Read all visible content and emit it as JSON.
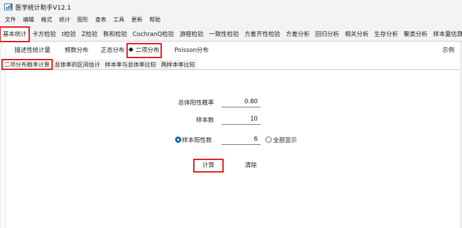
{
  "window": {
    "title": "医学统计助手V12.1"
  },
  "menu": [
    "文件",
    "编辑",
    "格式",
    "统计",
    "图形",
    "查表",
    "工具",
    "更新",
    "帮助"
  ],
  "main_tabs": [
    "基本统计",
    "卡方检验",
    "t检验",
    "Z检验",
    "秩和检验",
    "CochranQ检验",
    "游程检验",
    "一致性检验",
    "方差齐性检验",
    "方差分析",
    "回归分析",
    "相关分析",
    "生存分析",
    "聚类分析",
    "样本量估算"
  ],
  "sub_tabs": [
    "描述性统计量",
    "频数分布",
    "正态分布",
    "二项分布",
    "Poisson分布"
  ],
  "example_label": "示例",
  "inner_tabs": [
    "二项分布概率计算",
    "总体率的区间估计",
    "样本率与总体率比较",
    "两样本率比较"
  ],
  "form": {
    "prob_label": "总体阳性概率",
    "prob_value": "0.80",
    "n_label": "样本数",
    "n_value": "10",
    "k_label": "样本阳性数",
    "k_value": "6",
    "show_all_label": "全部显示",
    "calc_button": "计算",
    "clear_button": "清除"
  }
}
